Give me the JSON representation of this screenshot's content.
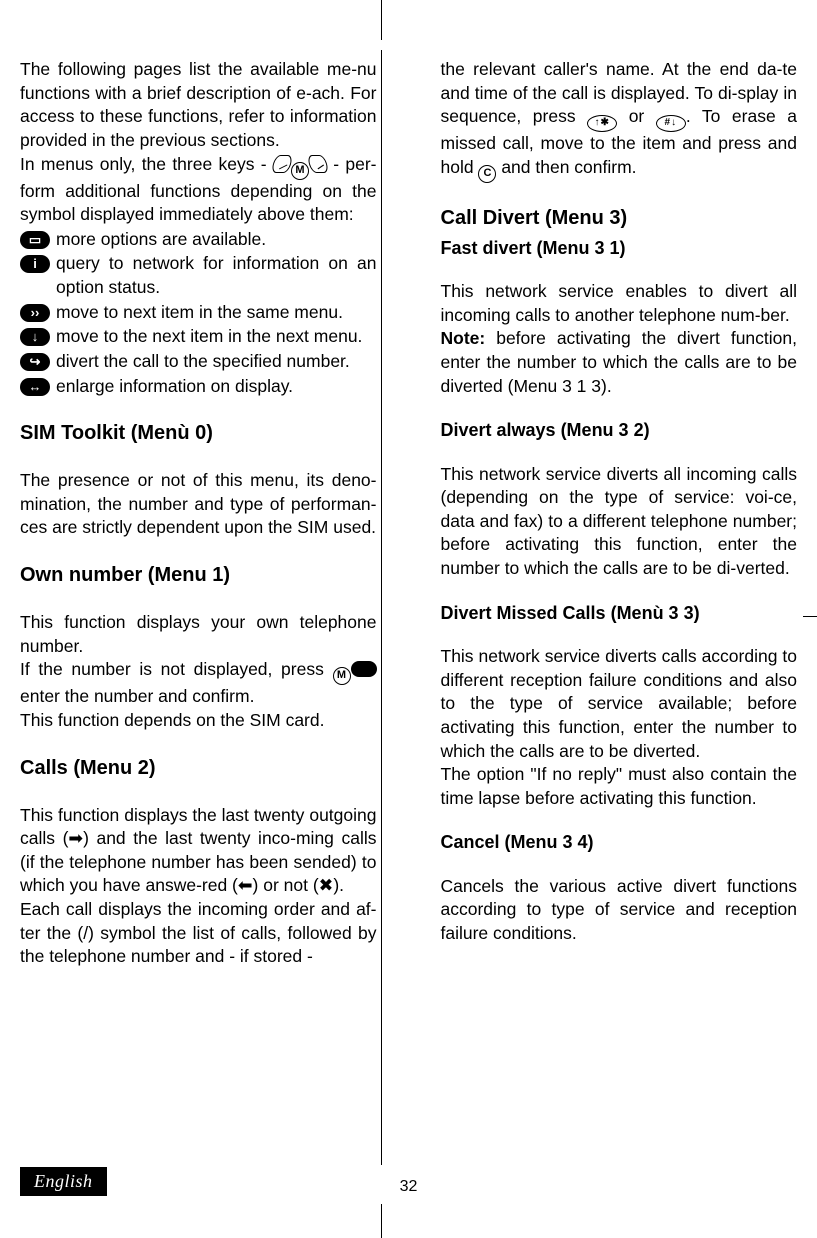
{
  "pageNumber": "32",
  "language": "English",
  "left": {
    "p1": "The following pages list the available me-nu functions with a brief description of e-ach. For access to these functions, refer to information provided in the previous sections.",
    "p2a": "In menus only, the three keys - ",
    "p2b": " - per-form additional functions depending on the symbol displayed immediately above them:",
    "opt1": "more options are available.",
    "opt2": "query to network for information on an option status.",
    "opt3": "move to next item in the same menu.",
    "opt4": "move to the next item in the next menu.",
    "opt5": "divert the call to the specified number.",
    "opt6": "enlarge information on display.",
    "h1": "SIM Toolkit (Menù 0)",
    "p3": "The presence or not of this menu, its deno-mination, the number and type of performan-ces are strictly dependent upon the SIM used.",
    "h2": "Own number (Menu 1)",
    "p4a": "This function displays your own telephone number.",
    "p4b_a": "If the number is not displayed, press ",
    "p4b_b": " enter the number and confirm.",
    "p4c": "This function depends on the SIM card.",
    "h3": "Calls (Menu 2)",
    "p5": "This function displays the last twenty outgoing calls (➡) and the last twenty inco-ming calls (if the telephone number has been sended) to which you have answe-red (⬅) or not (✖).",
    "p6": "Each call displays the incoming order and af-ter the (/) symbol the list of calls, followed by the telephone number and - if stored -"
  },
  "right": {
    "p1a": "the relevant caller's name. At the end da-te and time of the call is displayed. To di-splay in sequence, press ",
    "p1b": " or ",
    "p1c": ". To erase a missed call, move to the item and press and hold ",
    "p1d": " and then confirm.",
    "h1": "Call Divert (Menu 3)",
    "sh1": "Fast divert (Menu 3 1)",
    "p2": "This network service enables to divert all incoming calls to another telephone num-ber.",
    "noteLabel": "Note:",
    "p3": " before activating the divert function, enter the number to which the calls are to be diverted (Menu 3 1 3).",
    "sh2": "Divert always (Menu 3 2)",
    "p4": "This network service diverts all incoming calls (depending on the type of service: voi-ce, data and fax) to a different telephone number; before activating this function, enter the number to which the calls are to be di-verted.",
    "sh3": "Divert Missed Calls  (Menù 3 3)",
    "p5": "This network service diverts calls according to different reception failure conditions and also to the type of service available; before activating this function, enter the number to which the calls are to be diverted.",
    "p5b": "The option \"If no reply\" must also contain the time lapse before activating this function.",
    "sh4": "Cancel  (Menu 3 4)",
    "p6": "Cancels the various active divert functions according to type of service and reception failure conditions."
  }
}
